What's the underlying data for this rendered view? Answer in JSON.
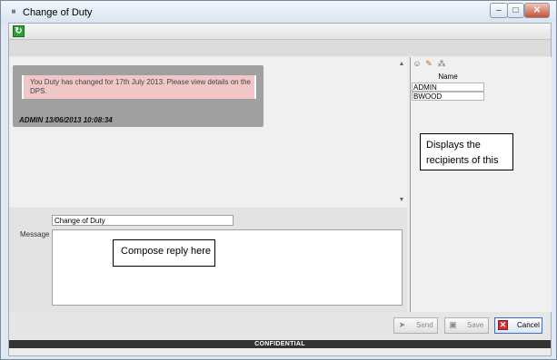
{
  "window": {
    "title": "Change of Duty",
    "app_icon": "app-logo-icon",
    "controls": [
      "minimize-icon",
      "maximize-icon",
      "close-icon"
    ],
    "controls_glyphs": {
      "minimize": "–",
      "maximize": "□",
      "close": "✕"
    }
  },
  "toolbar": {
    "refresh_icon": "refresh-icon",
    "refresh_glyph": "↻"
  },
  "message": {
    "text": "You Duty has changed for 17th July 2013. Please view details on the DPS.",
    "meta": "ADMIN 13/06/2013 10:08:34",
    "bubble_color": "#f0c6c6",
    "frame_color": "#a0a0a0"
  },
  "reply": {
    "subject_value": "Change of Duty",
    "message_label": "Message",
    "message_value": "",
    "callout": "Compose reply here"
  },
  "recipients": {
    "tools": [
      "add-users-icon",
      "edit-users-icon",
      "clear-users-icon"
    ],
    "column_header": "Name",
    "rows": [
      "ADMIN",
      "BWOOD"
    ],
    "callout": "Displays the recipients of this"
  },
  "buttons": {
    "send": {
      "label": "Send",
      "icon": "send-icon",
      "glyph": "➤",
      "enabled": false
    },
    "save": {
      "label": "Save",
      "icon": "save-icon",
      "glyph": "▣",
      "enabled": false
    },
    "cancel": {
      "label": "Cancel",
      "icon": "cancel-icon",
      "glyph": "✕",
      "enabled": true
    },
    "cancel_accent": "#d32e2e"
  },
  "status": {
    "text": "CONFIDENTIAL"
  }
}
